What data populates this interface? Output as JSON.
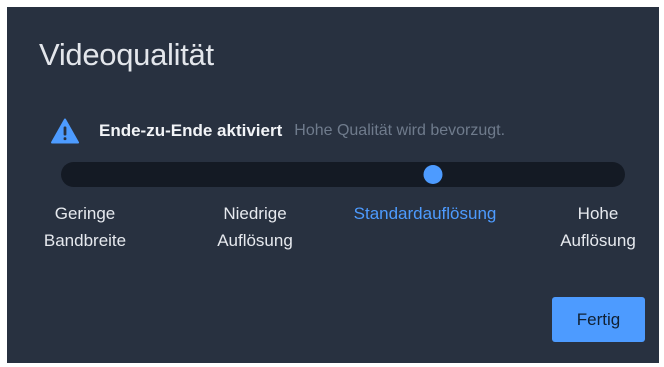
{
  "dialog": {
    "title": "Videoqualität",
    "notice": {
      "icon": "warning-triangle-icon",
      "strong": "Ende-zu-Ende aktiviert",
      "muted": "Hohe Qualität wird bevorzugt."
    },
    "slider": {
      "selected_index": 2,
      "stops": [
        {
          "label": "Geringe\nBandbreite"
        },
        {
          "label": "Niedrige\nAuflösung"
        },
        {
          "label": "Standardauflösung"
        },
        {
          "label": "Hohe\nAuflösung"
        }
      ]
    },
    "done_label": "Fertig"
  },
  "colors": {
    "dialog_bg": "#283140",
    "track": "#141a24",
    "accent": "#4d9bff",
    "text": "#e6e9ee",
    "muted": "#6f7b8c"
  }
}
